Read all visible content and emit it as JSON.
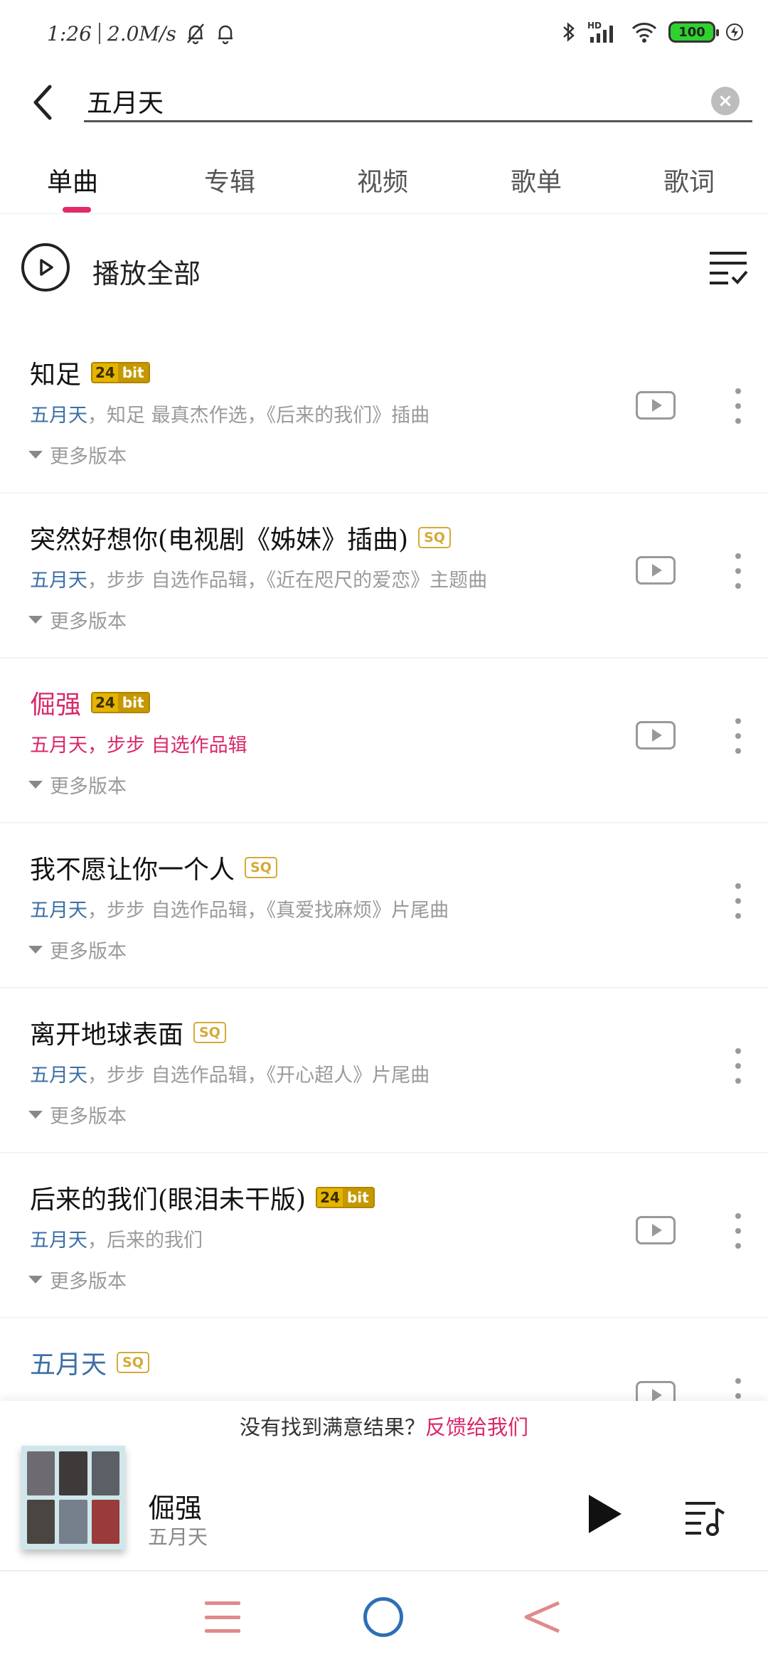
{
  "status_bar": {
    "time": "1:26",
    "speed": "2.0M/s",
    "battery": "100",
    "icons": [
      "mute-bell-icon",
      "bell-icon",
      "bluetooth-icon",
      "hd-signal-icon",
      "wifi-icon",
      "battery-icon",
      "charging-icon"
    ]
  },
  "search": {
    "query": "五月天",
    "back_icon": "back-arrow-icon",
    "clear_icon": "clear-icon",
    "clear_glyph": "×"
  },
  "tabs": [
    {
      "label": "单曲",
      "active": true
    },
    {
      "label": "专辑",
      "active": false
    },
    {
      "label": "视频",
      "active": false
    },
    {
      "label": "歌单",
      "active": false
    },
    {
      "label": "歌词",
      "active": false
    }
  ],
  "play_all": {
    "label": "播放全部",
    "icon": "play-circle-icon",
    "manage_icon": "list-check-icon"
  },
  "badges": {
    "hires_1": "24",
    "hires_2": "bit",
    "sq": "SQ"
  },
  "songs": [
    {
      "title": "知足",
      "badge": "24bit",
      "artist": "五月天",
      "detail": "，知足 最真杰作选，《后来的我们》插曲",
      "more": "更多版本",
      "playing": false
    },
    {
      "title": "突然好想你(电视剧《姊妹》插曲)",
      "badge": "SQ",
      "artist": "五月天",
      "detail": "，步步 自选作品辑，《近在咫尺的爱恋》主题曲",
      "more": "更多版本",
      "playing": false
    },
    {
      "title": "倔强",
      "badge": "24bit",
      "artist": "五月天",
      "detail": "，步步 自选作品辑",
      "more": "更多版本",
      "playing": true
    },
    {
      "title": "我不愿让你一个人",
      "badge": "SQ",
      "artist": "五月天",
      "detail": "，步步 自选作品辑，《真爱找麻烦》片尾曲",
      "more": "更多版本",
      "playing": false
    },
    {
      "title": "离开地球表面",
      "badge": "SQ",
      "artist": "五月天",
      "detail": "，步步 自选作品辑，《开心超人》片尾曲",
      "more": "更多版本",
      "playing": false
    },
    {
      "title": "后来的我们(眼泪未干版)",
      "badge": "24bit",
      "artist": "五月天",
      "detail": "，后来的我们",
      "more": "更多版本",
      "playing": false
    },
    {
      "title": "五月天",
      "badge": "SQ",
      "artist": "",
      "detail": "",
      "more": "",
      "playing": false
    }
  ],
  "feedback": {
    "text": "没有找到满意结果？",
    "link": "反馈给我们"
  },
  "player": {
    "title": "倔强",
    "artist": "五月天",
    "play_icon": "play-icon",
    "queue_icon": "playlist-icon"
  },
  "colors": {
    "accent": "#d8286a",
    "artist_blue": "#3c6fa5",
    "gold_badge": "#e4b400"
  }
}
